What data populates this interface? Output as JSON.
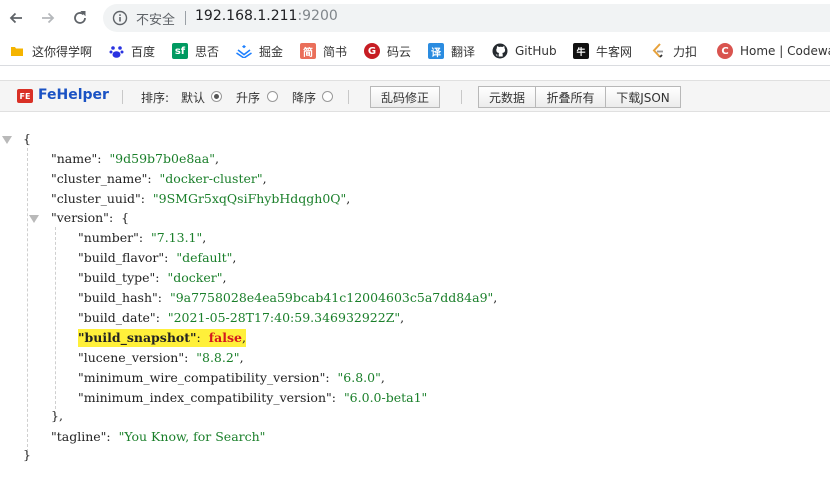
{
  "browser": {
    "insecure_label": "不安全",
    "url_host": "192.168.1.211",
    "url_port": ":9200"
  },
  "bookmarks": [
    {
      "label": "这你得学啊",
      "icon": "folder-icon",
      "color": "#f5b400"
    },
    {
      "label": "百度",
      "icon": "baidu-paw-icon",
      "color": "#2932e1"
    },
    {
      "label": "思否",
      "icon": "segmentfault-icon",
      "color": "#009a61",
      "glyph": "sf"
    },
    {
      "label": "掘金",
      "icon": "juejin-icon",
      "color": "#1e80ff"
    },
    {
      "label": "简书",
      "icon": "jianshu-icon",
      "color": "#ea6f5a",
      "glyph": "简"
    },
    {
      "label": "码云",
      "icon": "gitee-icon",
      "color": "#c71d23",
      "glyph": "G"
    },
    {
      "label": "翻译",
      "icon": "translate-icon",
      "color": "#2b8ce0",
      "glyph": "译"
    },
    {
      "label": "GitHub",
      "icon": "github-icon",
      "color": "#24292e"
    },
    {
      "label": "牛客网",
      "icon": "nowcoder-icon",
      "color": "#111111",
      "glyph": "牛"
    },
    {
      "label": "力扣",
      "icon": "leetcode-icon",
      "color": "#333333"
    },
    {
      "label": "Home | Codewa",
      "icon": "codewars-icon",
      "color": "#d9544f",
      "glyph": "C"
    }
  ],
  "toolbar": {
    "logo_text": "FE",
    "title": "FeHelper",
    "sort_label": "排序:",
    "sort_default": "默认",
    "sort_asc": "升序",
    "sort_desc": "降序",
    "fix_button": "乱码修正",
    "raw_button": "元数据",
    "collapse_button": "折叠所有",
    "download_button": "下载JSON"
  },
  "json": {
    "open_brace": "{",
    "close_brace": "}",
    "name_key": "\"name\"",
    "name_val": "\"9d59b7b0e8aa\"",
    "cluster_name_key": "\"cluster_name\"",
    "cluster_name_val": "\"docker-cluster\"",
    "cluster_uuid_key": "\"cluster_uuid\"",
    "cluster_uuid_val": "\"9SMGr5xqQsiFhybHdqgh0Q\"",
    "version_key": "\"version\"",
    "version_open": "{",
    "version_close": "},",
    "number_key": "\"number\"",
    "number_val": "\"7.13.1\"",
    "build_flavor_key": "\"build_flavor\"",
    "build_flavor_val": "\"default\"",
    "build_type_key": "\"build_type\"",
    "build_type_val": "\"docker\"",
    "build_hash_key": "\"build_hash\"",
    "build_hash_val": "\"9a7758028e4ea59bcab41c12004603c5a7dd84a9\"",
    "build_date_key": "\"build_date\"",
    "build_date_val": "\"2021-05-28T17:40:59.346932922Z\"",
    "build_snapshot_key": "\"build_snapshot\"",
    "build_snapshot_val": "false",
    "lucene_version_key": "\"lucene_version\"",
    "lucene_version_val": "\"8.8.2\"",
    "min_wire_key": "\"minimum_wire_compatibility_version\"",
    "min_wire_val": "\"6.8.0\"",
    "min_index_key": "\"minimum_index_compatibility_version\"",
    "min_index_val": "\"6.0.0-beta1\"",
    "tagline_key": "\"tagline\"",
    "tagline_val": "\"You Know, for Search\""
  }
}
